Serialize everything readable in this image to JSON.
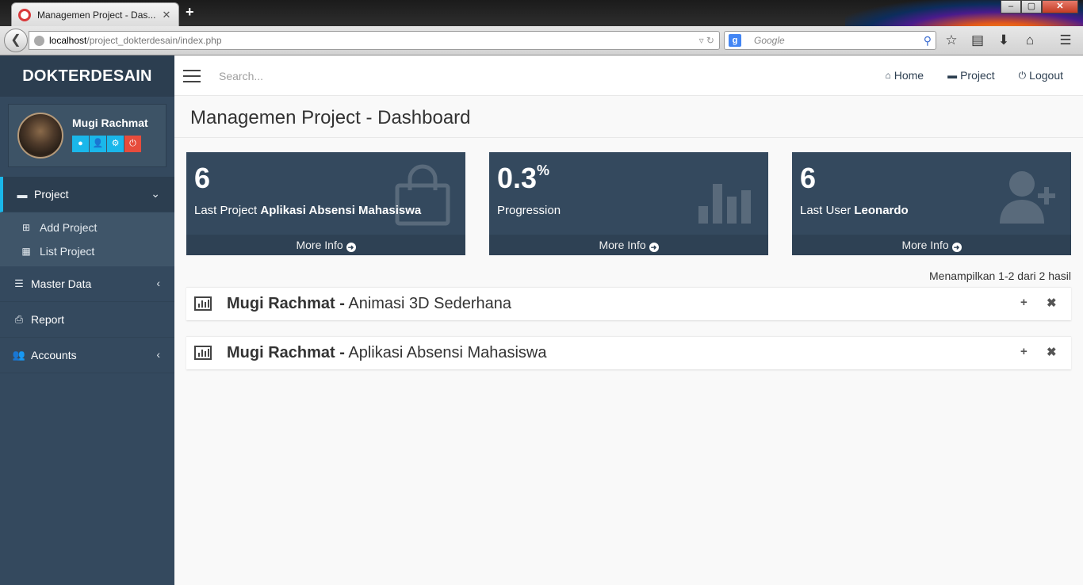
{
  "browser": {
    "tab_title": "Managemen Project - Das...",
    "tab_close": "✕",
    "new_tab": "+",
    "url_host": "localhost",
    "url_path": "/project_dokterdesain/index.php",
    "search_placeholder": "Google",
    "window_controls": [
      "–",
      "▢",
      "✕"
    ]
  },
  "sidebar": {
    "brand": "DOKTERDESAIN",
    "user": {
      "name": "Mugi Rachmat",
      "buttons": [
        {
          "icon": "circle-icon",
          "glyph": "●"
        },
        {
          "icon": "user-icon",
          "glyph": "👤"
        },
        {
          "icon": "gear-icon",
          "glyph": "⚙"
        },
        {
          "icon": "power-icon",
          "glyph": "⏻"
        }
      ]
    },
    "menu": [
      {
        "label": "Project",
        "icon": "archive-icon"
      },
      {
        "label": "Master Data",
        "icon": "list-icon"
      },
      {
        "label": "Report",
        "icon": "print-icon"
      },
      {
        "label": "Accounts",
        "icon": "users-icon"
      }
    ],
    "submenu": [
      {
        "label": "Add Project",
        "icon": "plus-square-icon"
      },
      {
        "label": "List Project",
        "icon": "grid-icon"
      }
    ]
  },
  "header": {
    "search_placeholder": "Search...",
    "nav": [
      {
        "label": "Home",
        "icon": "home-icon"
      },
      {
        "label": "Project",
        "icon": "archive-icon"
      },
      {
        "label": "Logout",
        "icon": "power-icon"
      }
    ]
  },
  "main": {
    "page_title": "Managemen Project - Dashboard",
    "stats": [
      {
        "value": "6",
        "suffix": "",
        "prefix": "Last Project ",
        "highlight": "Aplikasi Absensi Mahasiswa",
        "more": "More Info",
        "icon": "shopping-bag-icon"
      },
      {
        "value": "0.3",
        "suffix": "%",
        "prefix": "Progression",
        "highlight": "",
        "more": "More Info",
        "icon": "bar-chart-icon"
      },
      {
        "value": "6",
        "suffix": "",
        "prefix": "Last User ",
        "highlight": "Leonardo",
        "more": "More Info",
        "icon": "user-add-icon"
      }
    ],
    "result_count": "Menampilkan 1-2 dari 2 hasil",
    "projects": [
      {
        "owner": "Mugi Rachmat -",
        "name": " Animasi 3D Sederhana",
        "expand": "+",
        "remove": "✖"
      },
      {
        "owner": "Mugi Rachmat -",
        "name": " Aplikasi Absensi Mahasiswa",
        "expand": "+",
        "remove": "✖"
      }
    ]
  }
}
